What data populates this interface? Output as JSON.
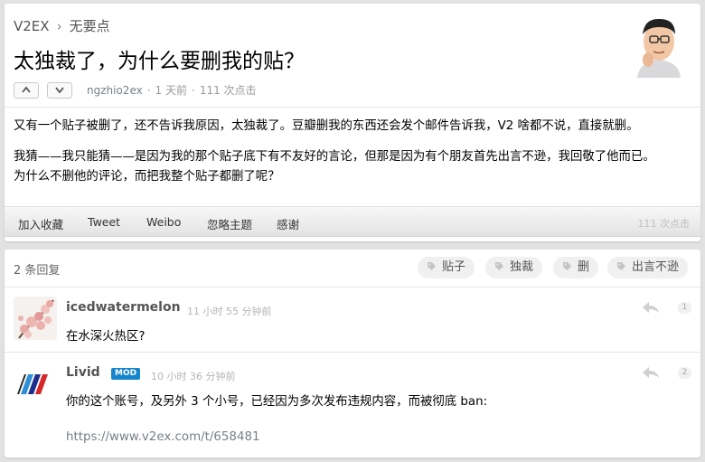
{
  "breadcrumb": {
    "site": "V2EX",
    "separator": "›",
    "node": "无要点"
  },
  "topic": {
    "title": "太独裁了，为什么要删我的贴？",
    "author": "ngzhio2ex",
    "time": "1 天前",
    "clicks": "111 次点击",
    "paragraph1": "又有一个贴子被删了，还不告诉我原因，太独裁了。豆瓣删我的东西还会发个邮件告诉我，V2 啥都不说，直接就删。",
    "paragraph2_line1": "我猜——我只能猜——是因为我的那个贴子底下有不友好的言论，但那是因为有个朋友首先出言不逊，我回敬了他而已。",
    "paragraph2_line2": "为什么不删他的评论，而把我整个贴子都删了呢？"
  },
  "toolbar": {
    "favorite": "加入收藏",
    "tweet": "Tweet",
    "weibo": "Weibo",
    "ignore": "忽略主题",
    "thanks": "感谢",
    "clicks": "111 次点击"
  },
  "replies_header": {
    "count": "2 条回复",
    "tags": [
      "贴子",
      "独裁",
      "删",
      "出言不逊"
    ]
  },
  "replies": [
    {
      "username": "icedwatermelon",
      "time": "11 小时 55 分钟前",
      "text": "在水深火热区?",
      "floor": "1"
    },
    {
      "username": "Livid",
      "badge": "MOD",
      "time": "10 小时 36 分钟前",
      "text": "你的这个账号，及另外 3 个小号，已经因为多次发布违规内容，而被彻底 ban:",
      "link": "https://www.v2ex.com/t/658481",
      "floor": "2"
    }
  ],
  "icons": {
    "vote_up": "chevron-up-icon",
    "vote_down": "chevron-down-icon",
    "tag": "tag-icon",
    "reply": "reply-arrow-icon"
  }
}
